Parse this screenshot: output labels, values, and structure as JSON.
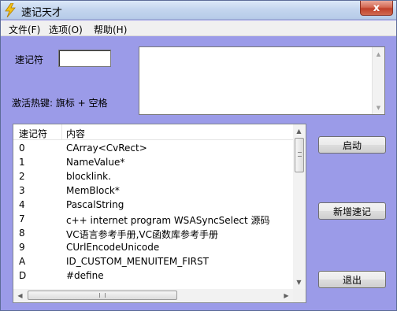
{
  "window": {
    "title": "速记天才",
    "close_label": "x"
  },
  "menu": {
    "items": [
      {
        "label": "文件(F)"
      },
      {
        "label": "选项(O)"
      },
      {
        "label": "帮助(H)"
      }
    ]
  },
  "form": {
    "shortcut_label": "速记符",
    "shortcut_value": "",
    "content_value": "",
    "hotkey_label": "激活热键: 旗标 + 空格"
  },
  "list": {
    "columns": [
      "速记符",
      "内容"
    ],
    "rows": [
      {
        "key": "0",
        "value": "CArray<CvRect>"
      },
      {
        "key": "1",
        "value": "NameValue*"
      },
      {
        "key": "2",
        "value": "blocklink."
      },
      {
        "key": "3",
        "value": "MemBlock*"
      },
      {
        "key": "4",
        "value": "PascalString"
      },
      {
        "key": "7",
        "value": "c++ internet program WSASyncSelect 源码"
      },
      {
        "key": "8",
        "value": "VC语言参考手册,VC函数库参考手册"
      },
      {
        "key": "9",
        "value": "CUrlEncodeUnicode"
      },
      {
        "key": "A",
        "value": "ID_CUSTOM_MENUITEM_FIRST"
      },
      {
        "key": "D",
        "value": "#define"
      }
    ]
  },
  "buttons": {
    "start": "启动",
    "add": "新增速记",
    "exit": "退出"
  },
  "icons": {
    "app": "lightning-bolt-icon",
    "close": "close-icon"
  },
  "colors": {
    "window_bg": "#9b9be8",
    "titlebar": "#c3d5ee",
    "close_button": "#c0402a"
  }
}
